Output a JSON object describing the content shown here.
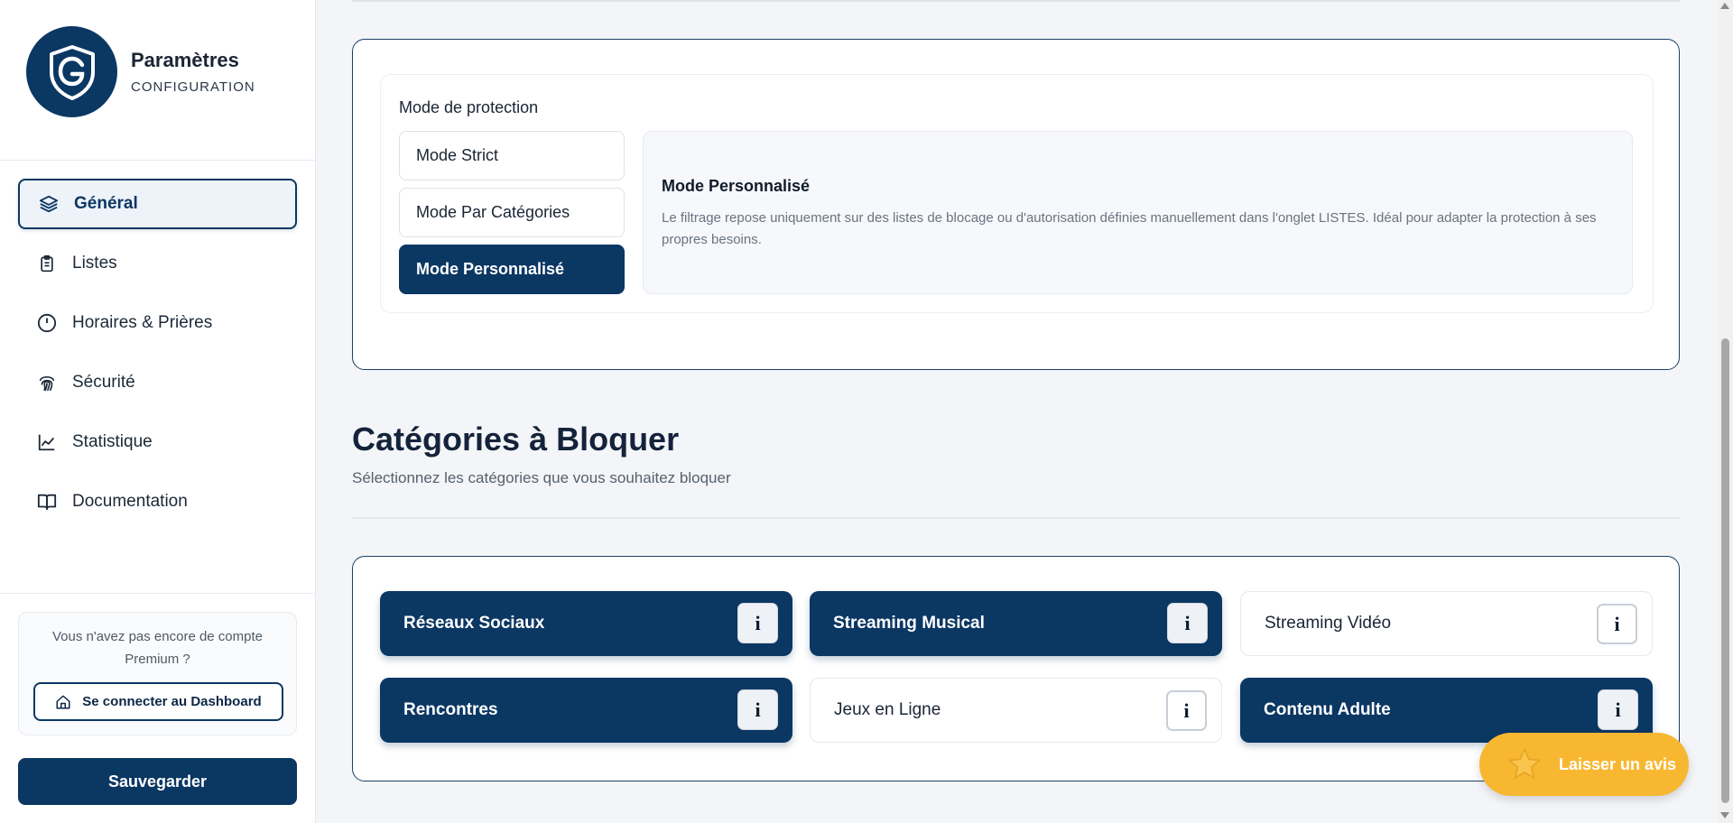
{
  "sidebar": {
    "brand_title": "Paramètres",
    "brand_subtitle": "CONFIGURATION",
    "logo_icon": "shield-g-icon",
    "nav": [
      {
        "label": "Général",
        "icon": "layers-icon",
        "active": true
      },
      {
        "label": "Listes",
        "icon": "clipboard-icon"
      },
      {
        "label": "Horaires & Prières",
        "icon": "clock-icon"
      },
      {
        "label": "Sécurité",
        "icon": "fingerprint-icon"
      },
      {
        "label": "Statistique",
        "icon": "line-chart-icon"
      },
      {
        "label": "Documentation",
        "icon": "book-icon"
      }
    ],
    "premium_text": "Vous n'avez pas encore de compte Premium ?",
    "dashboard_button": "Se connecter au Dashboard",
    "save_button": "Sauvegarder"
  },
  "mode": {
    "label": "Mode de protection",
    "options": [
      "Mode Strict",
      "Mode Par Catégories",
      "Mode Personnalisé"
    ],
    "selected": "Mode Personnalisé",
    "desc_title": "Mode Personnalisé",
    "desc_text": "Le filtrage repose uniquement sur des listes de blocage ou d'autorisation définies manuellement dans l'onglet LISTES. Idéal pour adapter la protection à ses propres besoins."
  },
  "categories": {
    "title": "Catégories à Bloquer",
    "subtitle": "Sélectionnez les catégories que vous souhaitez bloquer",
    "info_label": "i",
    "items": [
      {
        "label": "Réseaux Sociaux",
        "blocked": true
      },
      {
        "label": "Streaming Musical",
        "blocked": true
      },
      {
        "label": "Streaming Vidéo",
        "blocked": false
      },
      {
        "label": "Rencontres",
        "blocked": true
      },
      {
        "label": "Jeux en Ligne",
        "blocked": false
      },
      {
        "label": "Contenu Adulte",
        "blocked": true
      }
    ]
  },
  "review_button": "Laisser un avis",
  "colors": {
    "primary": "#0b3763",
    "accent": "#f7b731",
    "background": "#f3f5f8"
  }
}
